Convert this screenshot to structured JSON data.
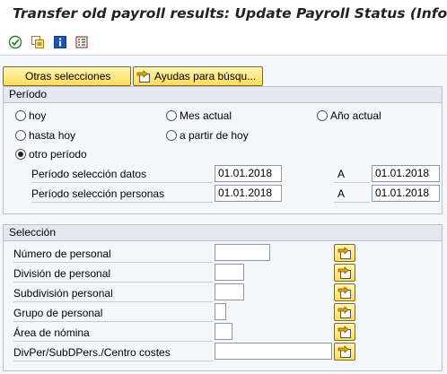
{
  "title": "Transfer old payroll results: Update Payroll Status (Infot",
  "toolbar": {
    "icons": [
      "execute-icon",
      "copy-variant-icon",
      "info-icon",
      "variant-list-icon"
    ]
  },
  "buttons": {
    "other_selections": "Otras selecciones",
    "search_help": "Ayudas para búsqu..."
  },
  "period": {
    "heading": "Período",
    "options": {
      "today": "hoy",
      "current_month": "Mes actual",
      "current_year": "Año actual",
      "until_today": "hasta hoy",
      "from_today": "a partir de hoy",
      "other_period": "otro período"
    },
    "selected": "other_period",
    "data_selection_label": "Período selección datos",
    "data_selection_from": "01.01.2018",
    "data_selection_to_label": "A",
    "data_selection_to": "01.01.2018",
    "person_selection_label": "Período selección personas",
    "person_selection_from": "01.01.2018",
    "person_selection_to_label": "A",
    "person_selection_to": "01.01.2018"
  },
  "selection": {
    "heading": "Selección",
    "fields": [
      {
        "label": "Número de personal",
        "value": ""
      },
      {
        "label": "División de personal",
        "value": ""
      },
      {
        "label": "Subdivisión personal",
        "value": ""
      },
      {
        "label": "Grupo de personal",
        "value": ""
      },
      {
        "label": "Área de nómina",
        "value": ""
      },
      {
        "label": "DivPer/SubDPers./Centro costes",
        "value": ""
      }
    ]
  },
  "colors": {
    "button_yellow": "#ffdb57",
    "group_header": "#e3e9ef",
    "background": "#f4f7fa"
  }
}
